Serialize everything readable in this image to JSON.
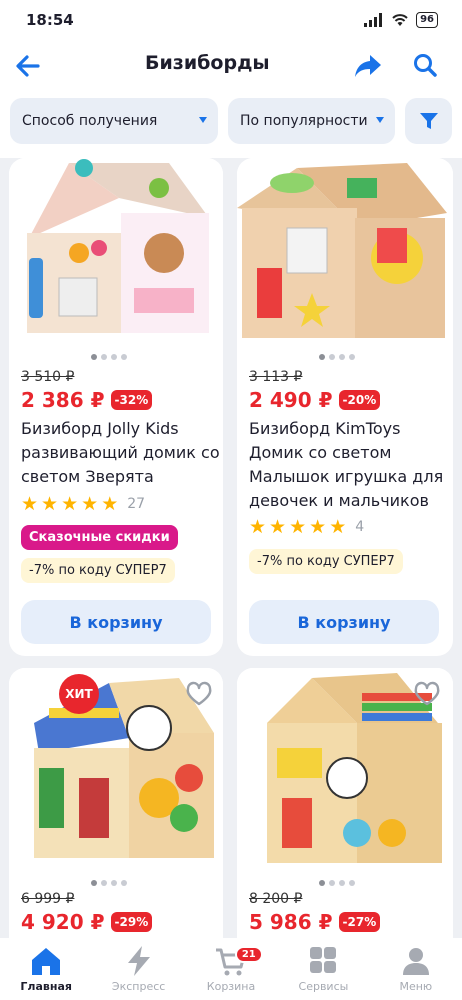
{
  "status": {
    "time": "18:54",
    "battery": "96",
    "signal": "signal-icon",
    "wifi": "wifi-icon"
  },
  "header": {
    "title": "Бизиборды"
  },
  "filters": {
    "delivery": "Способ получения",
    "sort": "По популярности"
  },
  "products": [
    {
      "old_price": "3 510 ₽",
      "price": "2 386 ₽",
      "discount": "-32%",
      "title": "Бизиборд Jolly Kids развивающий домик со светом Зверята",
      "rating": 5,
      "reviews": "27",
      "sale_badge": "Сказочные скидки",
      "promo": "-7% по коду СУПЕР7",
      "cart_label": "В корзину"
    },
    {
      "old_price": "3 113 ₽",
      "price": "2 490 ₽",
      "discount": "-20%",
      "title": "Бизиборд KimToys Домик со светом Малышок игрушка для девочек и мальчиков",
      "rating": 5,
      "reviews": "4",
      "promo": "-7% по коду СУПЕР7",
      "cart_label": "В корзину"
    },
    {
      "hit": "ХИТ",
      "old_price": "6 999 ₽",
      "price": "4 920 ₽",
      "discount": "-29%"
    },
    {
      "old_price": "8 200 ₽",
      "price": "5 986 ₽",
      "discount": "-27%"
    }
  ],
  "tabbar": {
    "home": "Главная",
    "express": "Экспресс",
    "cart": "Корзина",
    "cart_count": "21",
    "services": "Сервисы",
    "menu": "Меню"
  },
  "colors": {
    "accent": "#1a73e8",
    "price": "#e8262d",
    "sale": "#d9198a",
    "star": "#ffb400"
  }
}
